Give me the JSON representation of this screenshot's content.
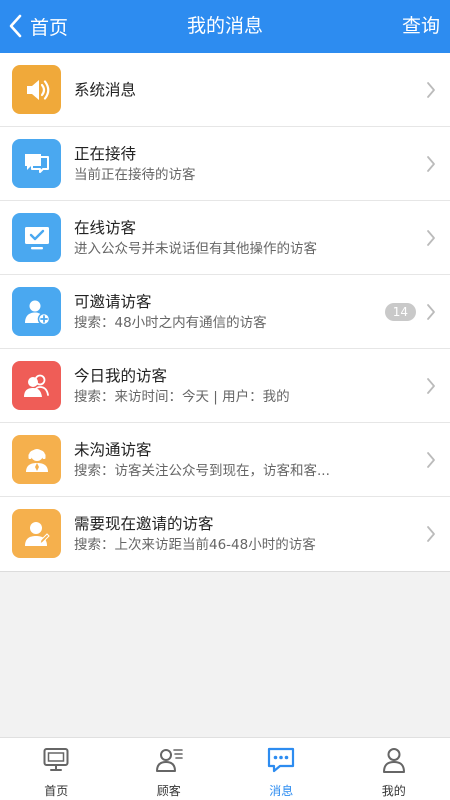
{
  "header": {
    "back_label": "首页",
    "title": "我的消息",
    "query_label": "查询",
    "color": "#2d8cf0"
  },
  "messages": [
    {
      "title": "系统消息",
      "subtitle": "",
      "icon": "speaker-icon",
      "color": "#f0a93a"
    },
    {
      "title": "正在接待",
      "subtitle": "当前正在接待的访客",
      "icon": "chat-bubbles-icon",
      "color": "#4aa8f0"
    },
    {
      "title": "在线访客",
      "subtitle": "进入公众号并未说话但有其他操作的访客",
      "icon": "monitor-check-icon",
      "color": "#4aa8f0"
    },
    {
      "title": "可邀请访客",
      "subtitle": "搜索：48小时之内有通信的访客",
      "icon": "user-add-icon",
      "color": "#4aa8f0",
      "badge": "14"
    },
    {
      "title": "今日我的访客",
      "subtitle": "搜索：来访时间：今天 | 用户：我的",
      "icon": "users-icon",
      "color": "#ef5d57"
    },
    {
      "title": "未沟通访客",
      "subtitle": "搜索：访客关注公众号到现在，访客和客...",
      "icon": "support-agent-icon",
      "color": "#f5b04d"
    },
    {
      "title": "需要现在邀请的访客",
      "subtitle": "搜索：上次来访距当前46-48小时的访客",
      "icon": "user-edit-icon",
      "color": "#f5b04d"
    }
  ],
  "tabbar": {
    "items": [
      {
        "label": "首页",
        "icon": "monitor-icon"
      },
      {
        "label": "顾客",
        "icon": "user-list-icon"
      },
      {
        "label": "消息",
        "icon": "message-icon",
        "active": true
      },
      {
        "label": "我的",
        "icon": "person-icon"
      }
    ],
    "active_color": "#2d8cf0"
  }
}
